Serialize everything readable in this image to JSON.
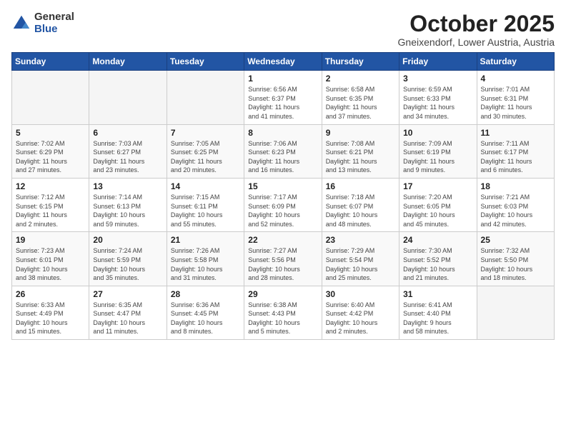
{
  "logo": {
    "general": "General",
    "blue": "Blue"
  },
  "header": {
    "month": "October 2025",
    "location": "Gneixendorf, Lower Austria, Austria"
  },
  "weekdays": [
    "Sunday",
    "Monday",
    "Tuesday",
    "Wednesday",
    "Thursday",
    "Friday",
    "Saturday"
  ],
  "weeks": [
    [
      {
        "day": "",
        "info": ""
      },
      {
        "day": "",
        "info": ""
      },
      {
        "day": "",
        "info": ""
      },
      {
        "day": "1",
        "info": "Sunrise: 6:56 AM\nSunset: 6:37 PM\nDaylight: 11 hours\nand 41 minutes."
      },
      {
        "day": "2",
        "info": "Sunrise: 6:58 AM\nSunset: 6:35 PM\nDaylight: 11 hours\nand 37 minutes."
      },
      {
        "day": "3",
        "info": "Sunrise: 6:59 AM\nSunset: 6:33 PM\nDaylight: 11 hours\nand 34 minutes."
      },
      {
        "day": "4",
        "info": "Sunrise: 7:01 AM\nSunset: 6:31 PM\nDaylight: 11 hours\nand 30 minutes."
      }
    ],
    [
      {
        "day": "5",
        "info": "Sunrise: 7:02 AM\nSunset: 6:29 PM\nDaylight: 11 hours\nand 27 minutes."
      },
      {
        "day": "6",
        "info": "Sunrise: 7:03 AM\nSunset: 6:27 PM\nDaylight: 11 hours\nand 23 minutes."
      },
      {
        "day": "7",
        "info": "Sunrise: 7:05 AM\nSunset: 6:25 PM\nDaylight: 11 hours\nand 20 minutes."
      },
      {
        "day": "8",
        "info": "Sunrise: 7:06 AM\nSunset: 6:23 PM\nDaylight: 11 hours\nand 16 minutes."
      },
      {
        "day": "9",
        "info": "Sunrise: 7:08 AM\nSunset: 6:21 PM\nDaylight: 11 hours\nand 13 minutes."
      },
      {
        "day": "10",
        "info": "Sunrise: 7:09 AM\nSunset: 6:19 PM\nDaylight: 11 hours\nand 9 minutes."
      },
      {
        "day": "11",
        "info": "Sunrise: 7:11 AM\nSunset: 6:17 PM\nDaylight: 11 hours\nand 6 minutes."
      }
    ],
    [
      {
        "day": "12",
        "info": "Sunrise: 7:12 AM\nSunset: 6:15 PM\nDaylight: 11 hours\nand 2 minutes."
      },
      {
        "day": "13",
        "info": "Sunrise: 7:14 AM\nSunset: 6:13 PM\nDaylight: 10 hours\nand 59 minutes."
      },
      {
        "day": "14",
        "info": "Sunrise: 7:15 AM\nSunset: 6:11 PM\nDaylight: 10 hours\nand 55 minutes."
      },
      {
        "day": "15",
        "info": "Sunrise: 7:17 AM\nSunset: 6:09 PM\nDaylight: 10 hours\nand 52 minutes."
      },
      {
        "day": "16",
        "info": "Sunrise: 7:18 AM\nSunset: 6:07 PM\nDaylight: 10 hours\nand 48 minutes."
      },
      {
        "day": "17",
        "info": "Sunrise: 7:20 AM\nSunset: 6:05 PM\nDaylight: 10 hours\nand 45 minutes."
      },
      {
        "day": "18",
        "info": "Sunrise: 7:21 AM\nSunset: 6:03 PM\nDaylight: 10 hours\nand 42 minutes."
      }
    ],
    [
      {
        "day": "19",
        "info": "Sunrise: 7:23 AM\nSunset: 6:01 PM\nDaylight: 10 hours\nand 38 minutes."
      },
      {
        "day": "20",
        "info": "Sunrise: 7:24 AM\nSunset: 5:59 PM\nDaylight: 10 hours\nand 35 minutes."
      },
      {
        "day": "21",
        "info": "Sunrise: 7:26 AM\nSunset: 5:58 PM\nDaylight: 10 hours\nand 31 minutes."
      },
      {
        "day": "22",
        "info": "Sunrise: 7:27 AM\nSunset: 5:56 PM\nDaylight: 10 hours\nand 28 minutes."
      },
      {
        "day": "23",
        "info": "Sunrise: 7:29 AM\nSunset: 5:54 PM\nDaylight: 10 hours\nand 25 minutes."
      },
      {
        "day": "24",
        "info": "Sunrise: 7:30 AM\nSunset: 5:52 PM\nDaylight: 10 hours\nand 21 minutes."
      },
      {
        "day": "25",
        "info": "Sunrise: 7:32 AM\nSunset: 5:50 PM\nDaylight: 10 hours\nand 18 minutes."
      }
    ],
    [
      {
        "day": "26",
        "info": "Sunrise: 6:33 AM\nSunset: 4:49 PM\nDaylight: 10 hours\nand 15 minutes."
      },
      {
        "day": "27",
        "info": "Sunrise: 6:35 AM\nSunset: 4:47 PM\nDaylight: 10 hours\nand 11 minutes."
      },
      {
        "day": "28",
        "info": "Sunrise: 6:36 AM\nSunset: 4:45 PM\nDaylight: 10 hours\nand 8 minutes."
      },
      {
        "day": "29",
        "info": "Sunrise: 6:38 AM\nSunset: 4:43 PM\nDaylight: 10 hours\nand 5 minutes."
      },
      {
        "day": "30",
        "info": "Sunrise: 6:40 AM\nSunset: 4:42 PM\nDaylight: 10 hours\nand 2 minutes."
      },
      {
        "day": "31",
        "info": "Sunrise: 6:41 AM\nSunset: 4:40 PM\nDaylight: 9 hours\nand 58 minutes."
      },
      {
        "day": "",
        "info": ""
      }
    ]
  ]
}
